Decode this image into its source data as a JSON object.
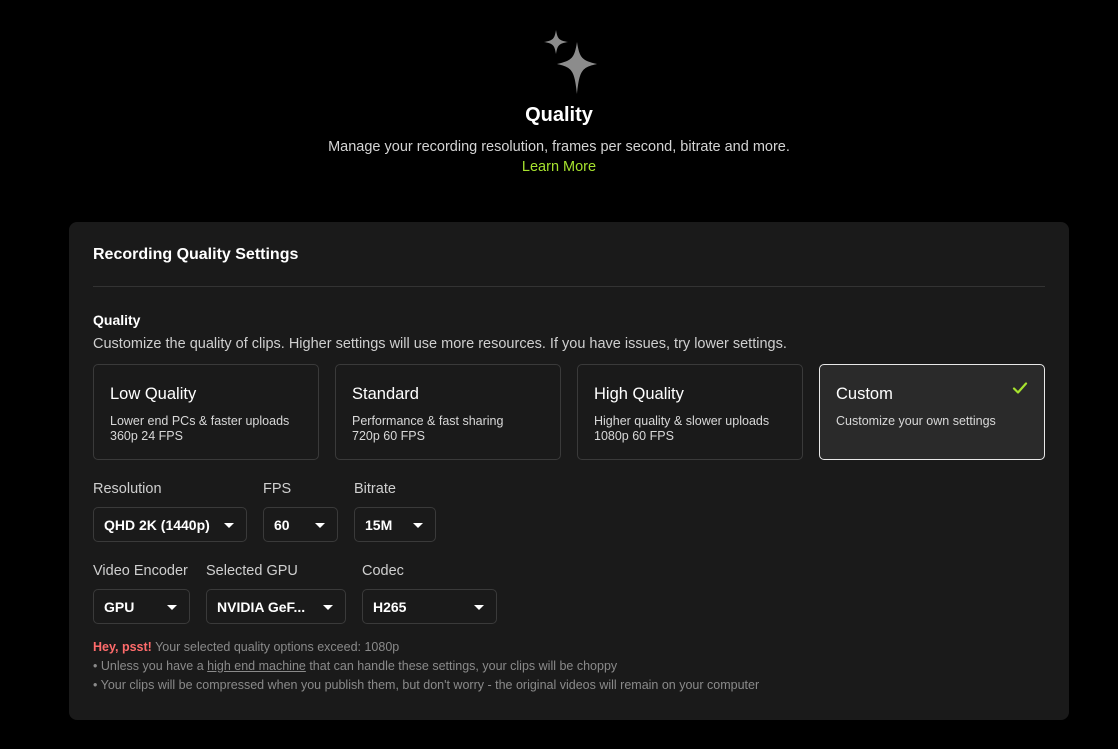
{
  "header": {
    "icon": "sparkles-icon",
    "title": "Quality",
    "subtitle": "Manage your recording resolution, frames per second, bitrate and more.",
    "learn_more": "Learn More"
  },
  "card": {
    "title": "Recording Quality Settings",
    "quality_label": "Quality",
    "quality_desc": "Customize the quality of clips. Higher settings will use more resources. If you have issues, try lower settings.",
    "presets": [
      {
        "name": "Low Quality",
        "line1": "Lower end PCs & faster uploads",
        "line2": "360p 24 FPS",
        "selected": false
      },
      {
        "name": "Standard",
        "line1": "Performance & fast sharing",
        "line2": "720p 60 FPS",
        "selected": false
      },
      {
        "name": "High Quality",
        "line1": "Higher quality & slower uploads",
        "line2": "1080p 60 FPS",
        "selected": false
      },
      {
        "name": "Custom",
        "line1": "Customize your own settings",
        "line2": "",
        "selected": true
      }
    ],
    "fields": {
      "resolution": {
        "label": "Resolution",
        "value": "QHD 2K (1440p)"
      },
      "fps": {
        "label": "FPS",
        "value": "60"
      },
      "bitrate": {
        "label": "Bitrate",
        "value": "15M"
      },
      "encoder": {
        "label": "Video Encoder",
        "value": "GPU"
      },
      "gpu": {
        "label": "Selected GPU",
        "value": "NVIDIA GeF..."
      },
      "codec": {
        "label": "Codec",
        "value": "H265"
      }
    },
    "warning": {
      "strong": "Hey, psst!",
      "main": " Your selected quality options exceed: 1080p",
      "bullet1_pre": "• Unless you have a ",
      "bullet1_link": "high end machine",
      "bullet1_post": " that can handle these settings, your clips will be choppy",
      "bullet2": "• Your clips will be compressed when you publish them, but don't worry - the original videos will remain on your computer"
    }
  },
  "colors": {
    "accent": "#a6e22e",
    "warning": "#ff6b6b",
    "card_bg": "#1a1a1a",
    "page_bg": "#000000"
  }
}
